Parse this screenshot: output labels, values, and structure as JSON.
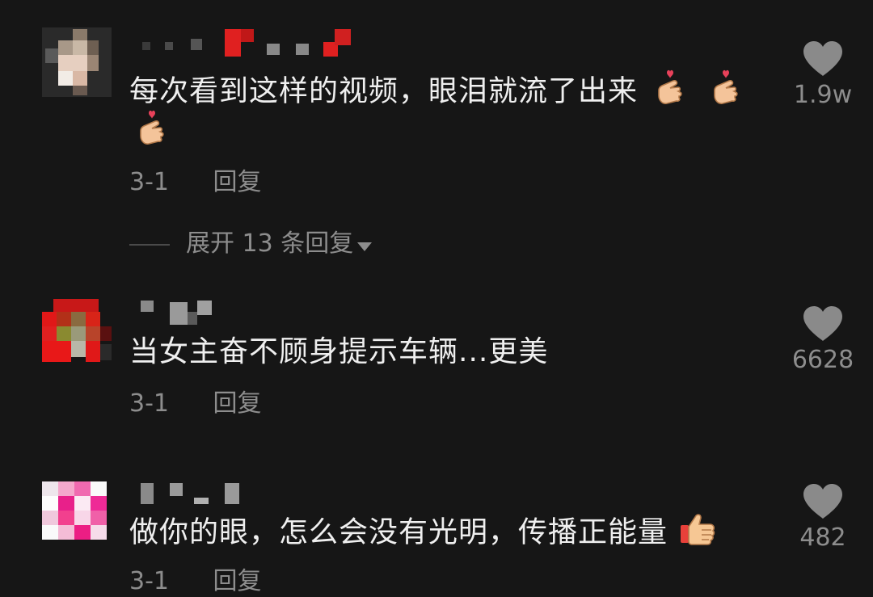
{
  "comments": [
    {
      "text": "每次看到这样的视频，眼泪就流了出来",
      "emoji": "finger-heart-icon",
      "date": "3-1",
      "reply_label": "回复",
      "likes": "1.9w"
    },
    {
      "text": "当女主奋不顾身提示车辆...更美",
      "date": "3-1",
      "reply_label": "回复",
      "likes": "6628"
    },
    {
      "text": "做你的眼，怎么会没有光明，传播正能量",
      "emoji": "thumbs-up-icon",
      "date": "3-1",
      "reply_label": "回复",
      "likes": "482"
    }
  ],
  "expand_replies": {
    "label": "展开 13 条回复"
  },
  "colors": {
    "background": "#161616",
    "text": "#efefef",
    "secondary": "#8d8d8d",
    "heart": "#8a8a8a"
  }
}
